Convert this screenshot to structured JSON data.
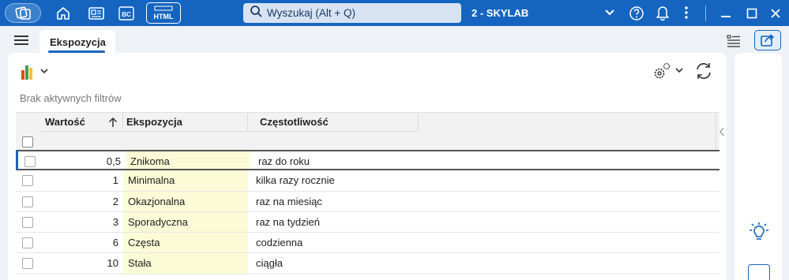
{
  "topbar": {
    "search_placeholder": "Wyszukaj (Alt + Q)",
    "company": "2 - SKYLAB",
    "bc_label": "BC",
    "html_label": "HTML",
    "accent": "#1565c0"
  },
  "tabs": [
    {
      "label": "Ekspozycja",
      "active": true
    }
  ],
  "toolbar": {
    "filters_text": "Brak aktywnych filtrów"
  },
  "grid": {
    "columns": [
      "Wartość",
      "Ekspozycja",
      "Częstotliwość"
    ],
    "sort": {
      "column": "Wartość",
      "direction": "ascending"
    },
    "rows": [
      {
        "wartosc": "0,5",
        "ekspozycja": "Znikoma",
        "czestotliwosc": "raz do roku",
        "selected": true
      },
      {
        "wartosc": "1",
        "ekspozycja": "Minimalna",
        "czestotliwosc": "kilka razy rocznie"
      },
      {
        "wartosc": "2",
        "ekspozycja": "Okazjonalna",
        "czestotliwosc": "raz na miesiąc"
      },
      {
        "wartosc": "3",
        "ekspozycja": "Sporadyczna",
        "czestotliwosc": "raz na tydzień"
      },
      {
        "wartosc": "6",
        "ekspozycja": "Częsta",
        "czestotliwosc": "codzienna"
      },
      {
        "wartosc": "10",
        "ekspozycja": "Stała",
        "czestotliwosc": "ciągła"
      }
    ]
  },
  "icons": {
    "logo": "app-logo-icon",
    "home": "home-icon",
    "doc": "document-icon",
    "search": "search-icon",
    "help": "help-icon",
    "bell": "bell-icon",
    "more": "more-vertical-icon",
    "chart": "bar-chart-icon",
    "settings": "gears-icon",
    "refresh": "refresh-icon",
    "bulb": "lightbulb-icon",
    "share": "share-icon"
  }
}
